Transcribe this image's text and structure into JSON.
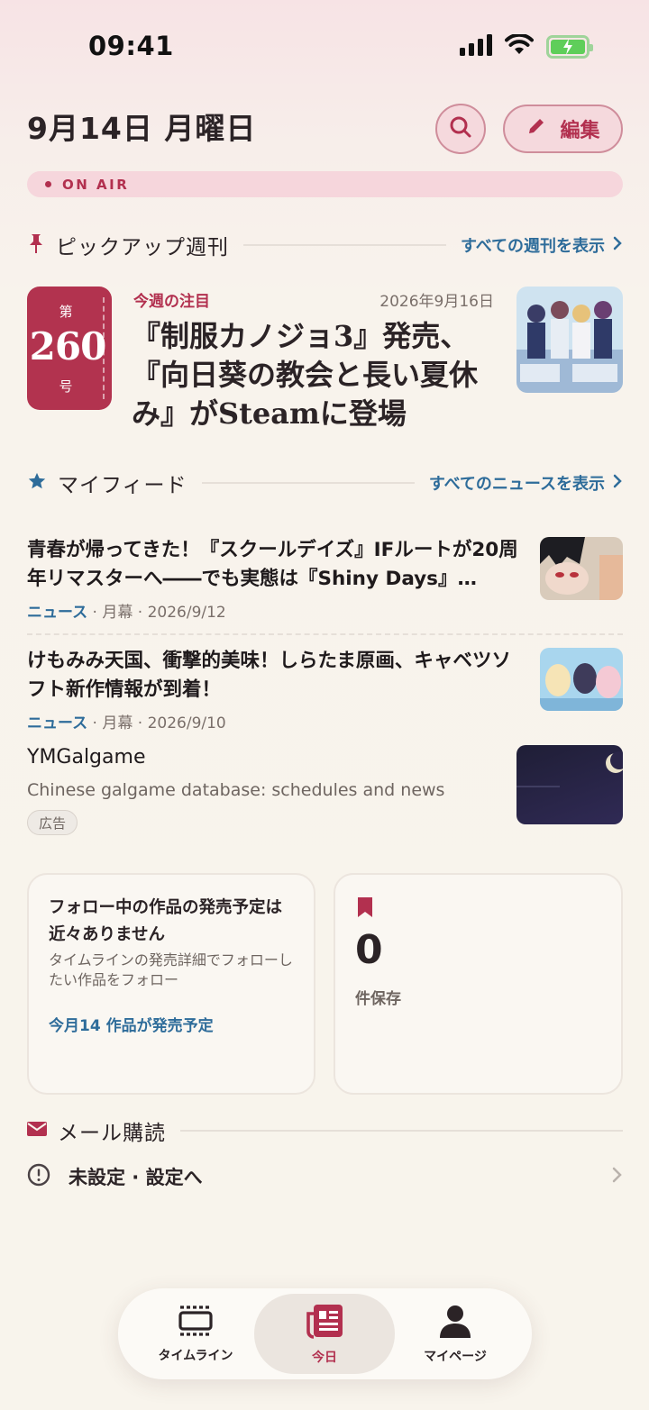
{
  "status_bar": {
    "time": "09:41"
  },
  "header": {
    "date": "9月14日 月曜日",
    "edit_label": "編集",
    "onair_label": "ON AIR"
  },
  "pickup": {
    "section_title": "ピックアップ週刊",
    "see_all": "すべての週刊を表示",
    "issue_prefix": "第",
    "issue_number": "260",
    "issue_suffix": "号",
    "label": "今週の注目",
    "date": "2026年9月16日",
    "title": "『制服カノジョ3』発売、『向日葵の教会と長い夏休み』がSteamに登場"
  },
  "feed": {
    "section_title": "マイフィード",
    "see_all": "すべてのニュースを表示",
    "items": [
      {
        "title": "青春が帰ってきた！『スクールデイズ』IFルートが20周年リマスターへ――でも実態は『Shiny Days』…",
        "category": "ニュース",
        "meta": " · 月幕 · 2026/9/12"
      },
      {
        "title": "けもみみ天国、衝撃的美味！しらたま原画、キャベツソフト新作情報が到着！",
        "category": "ニュース",
        "meta": " · 月幕 · 2026/9/10"
      }
    ],
    "ad": {
      "title": "YMGalgame",
      "description": "Chinese galgame database: schedules and news",
      "tag": "広告"
    }
  },
  "cards": {
    "release": {
      "title": "フォロー中の作品の発売予定は近々ありません",
      "description": "タイムラインの発売詳細でフォローしたい作品をフォロー",
      "link": "今月14 作品が発売予定"
    },
    "saved": {
      "count": "0",
      "label": "件保存"
    }
  },
  "mail": {
    "section_title": "メール購読",
    "status": "未設定 · 設定へ"
  },
  "tabbar": {
    "tabs": [
      {
        "label": "タイムライン",
        "icon": "timeline-icon"
      },
      {
        "label": "今日",
        "icon": "newspaper-icon",
        "active": true
      },
      {
        "label": "マイページ",
        "icon": "person-icon"
      }
    ]
  },
  "colors": {
    "accent": "#b2304f",
    "link": "#2e6c9a",
    "background": "#f8f4ec"
  }
}
